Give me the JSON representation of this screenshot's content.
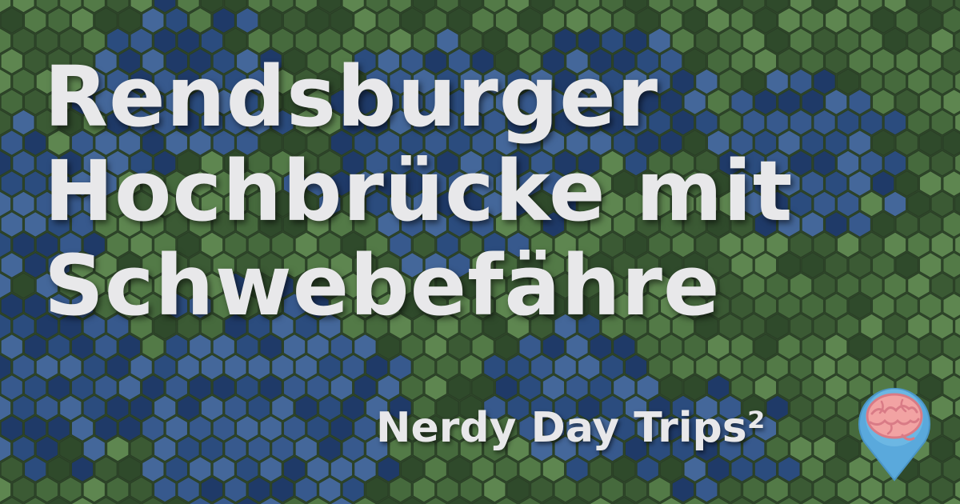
{
  "title_lines": [
    "Rendsburger",
    "Hochbrücke mit",
    "Schwebefähre"
  ],
  "brand": "Nerdy Day Trips²",
  "logo_icon": "brain-map-pin-icon",
  "colors": {
    "text": "#e8e8ea",
    "green_tones": [
      "#2f4a2b",
      "#3b5a34",
      "#466a3d",
      "#537a47",
      "#5e8650"
    ],
    "blue_tones": [
      "#1f3a68",
      "#2b4c7e",
      "#37598d",
      "#44679a"
    ],
    "pin": "#5aa9dc",
    "brain": "#f2a3a3"
  }
}
